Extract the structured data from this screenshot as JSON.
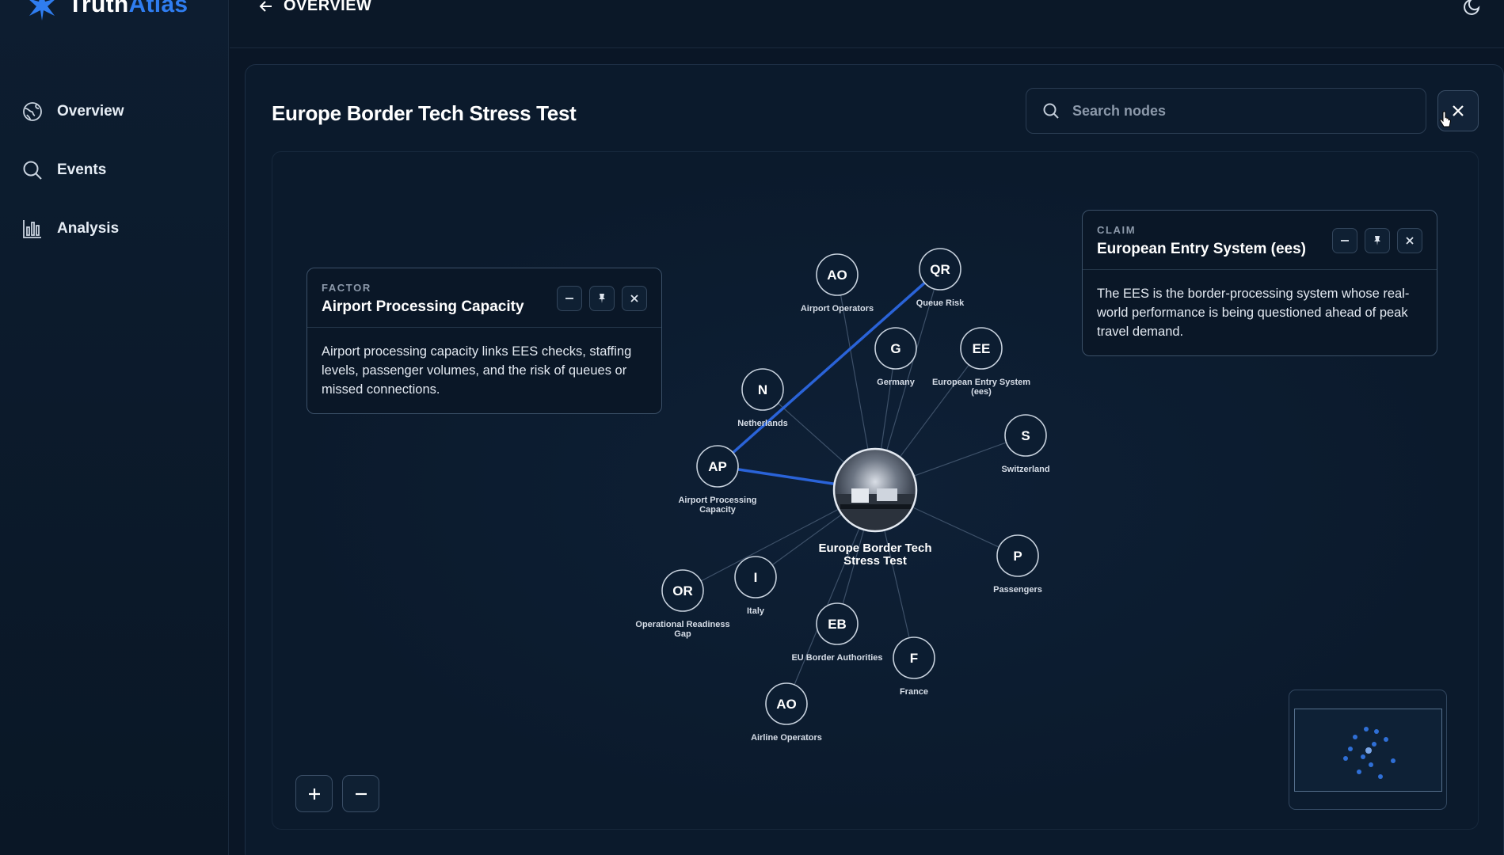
{
  "brand": {
    "name_part1": "Truth",
    "name_part2": "Atlas",
    "accent": "#2f7df0"
  },
  "sidebar": {
    "items": [
      {
        "label": "Overview",
        "icon": "globe-icon"
      },
      {
        "label": "Events",
        "icon": "search-icon"
      },
      {
        "label": "Analysis",
        "icon": "bar-chart-icon"
      }
    ]
  },
  "topbar": {
    "back_label": "OVERVIEW",
    "theme_icon": "moon-icon"
  },
  "page": {
    "title": "Europe Border Tech Stress Test"
  },
  "search": {
    "placeholder": "Search nodes",
    "value": ""
  },
  "cards": {
    "factor": {
      "kicker": "FACTOR",
      "title": "Airport Processing Capacity",
      "body": "Airport processing capacity links EES checks, staffing levels, passenger volumes, and the risk of queues or missed connections."
    },
    "claim": {
      "kicker": "CLAIM",
      "title": "European Entry System (ees)",
      "body": "The EES is the border-processing system whose real-world performance is being questioned ahead of peak travel demand."
    }
  },
  "graph": {
    "center": {
      "id": "center",
      "label_line1": "Europe Border Tech",
      "label_line2": "Stress Test"
    },
    "nodes": [
      {
        "id": "ao1",
        "abbr": "AO",
        "label": "Airport Operators"
      },
      {
        "id": "qr",
        "abbr": "QR",
        "label": "Queue Risk"
      },
      {
        "id": "g",
        "abbr": "G",
        "label": "Germany"
      },
      {
        "id": "ee",
        "abbr": "EE",
        "label": "European Entry System",
        "label2": "(ees)"
      },
      {
        "id": "n",
        "abbr": "N",
        "label": "Netherlands"
      },
      {
        "id": "s",
        "abbr": "S",
        "label": "Switzerland"
      },
      {
        "id": "ap",
        "abbr": "AP",
        "label": "Airport Processing",
        "label2": "Capacity"
      },
      {
        "id": "p",
        "abbr": "P",
        "label": "Passengers"
      },
      {
        "id": "i",
        "abbr": "I",
        "label": "Italy"
      },
      {
        "id": "or",
        "abbr": "OR",
        "label": "Operational Readiness",
        "label2": "Gap"
      },
      {
        "id": "eb",
        "abbr": "EB",
        "label": "EU Border Authorities"
      },
      {
        "id": "f",
        "abbr": "F",
        "label": "France"
      },
      {
        "id": "ao2",
        "abbr": "AO",
        "label": "Airline Operators"
      }
    ],
    "highlight_color": "#2a63d8",
    "edge_color": "#3d5068"
  }
}
